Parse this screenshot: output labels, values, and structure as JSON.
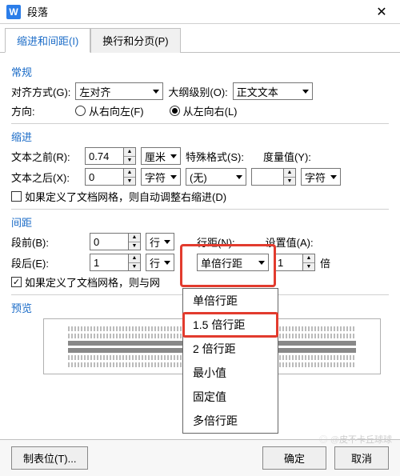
{
  "titlebar": {
    "app_glyph": "W",
    "title": "段落"
  },
  "tabs": {
    "indent": "缩进和间距(I)",
    "pagebreak": "换行和分页(P)"
  },
  "general": {
    "heading": "常规",
    "align_label": "对齐方式(G):",
    "align_value": "左对齐",
    "outline_label": "大纲级别(O):",
    "outline_value": "正文文本",
    "direction_label": "方向:",
    "rtl_label": "从右向左(F)",
    "ltr_label": "从左向右(L)"
  },
  "indent": {
    "heading": "缩进",
    "before_label": "文本之前(R):",
    "before_value": "0.74",
    "before_unit": "厘米",
    "special_label": "特殊格式(S):",
    "special_value": "(无)",
    "measure_label": "度量值(Y):",
    "after_label": "文本之后(X):",
    "after_value": "0",
    "after_unit": "字符",
    "measure_unit": "字符",
    "auto_adjust": "如果定义了文档网格，则自动调整右缩进(D)"
  },
  "spacing": {
    "heading": "间距",
    "before_para_label": "段前(B):",
    "before_para_value": "0",
    "after_para_label": "段后(E):",
    "after_para_value": "1",
    "para_unit": "行",
    "line_spacing_label": "行距(N):",
    "line_spacing_value": "单倍行距",
    "set_value_label": "设置值(A):",
    "set_value": "1",
    "set_unit": "倍",
    "snap_grid": "如果定义了文档网格，则与网",
    "options": [
      "单倍行距",
      "1.5 倍行距",
      "2 倍行距",
      "最小值",
      "固定值",
      "多倍行距"
    ]
  },
  "preview": {
    "heading": "预览"
  },
  "footer": {
    "tabstops": "制表位(T)...",
    "ok": "确定",
    "cancel": "取消"
  },
  "watermark": "皮不卡丘球球"
}
